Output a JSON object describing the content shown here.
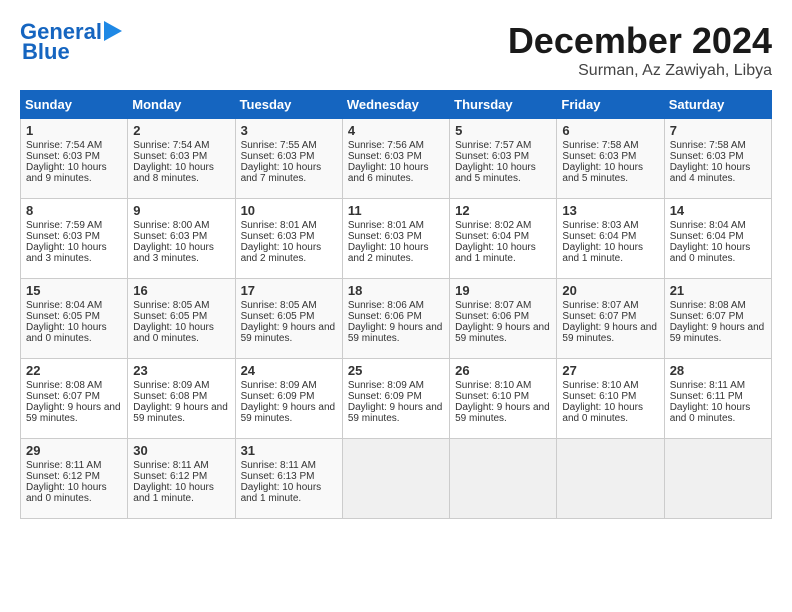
{
  "header": {
    "logo_line1": "General",
    "logo_line2": "Blue",
    "month": "December 2024",
    "location": "Surman, Az Zawiyah, Libya"
  },
  "days_of_week": [
    "Sunday",
    "Monday",
    "Tuesday",
    "Wednesday",
    "Thursday",
    "Friday",
    "Saturday"
  ],
  "weeks": [
    [
      {
        "day": 1,
        "info": "Sunrise: 7:54 AM\nSunset: 6:03 PM\nDaylight: 10 hours and 9 minutes."
      },
      {
        "day": 2,
        "info": "Sunrise: 7:54 AM\nSunset: 6:03 PM\nDaylight: 10 hours and 8 minutes."
      },
      {
        "day": 3,
        "info": "Sunrise: 7:55 AM\nSunset: 6:03 PM\nDaylight: 10 hours and 7 minutes."
      },
      {
        "day": 4,
        "info": "Sunrise: 7:56 AM\nSunset: 6:03 PM\nDaylight: 10 hours and 6 minutes."
      },
      {
        "day": 5,
        "info": "Sunrise: 7:57 AM\nSunset: 6:03 PM\nDaylight: 10 hours and 5 minutes."
      },
      {
        "day": 6,
        "info": "Sunrise: 7:58 AM\nSunset: 6:03 PM\nDaylight: 10 hours and 5 minutes."
      },
      {
        "day": 7,
        "info": "Sunrise: 7:58 AM\nSunset: 6:03 PM\nDaylight: 10 hours and 4 minutes."
      }
    ],
    [
      {
        "day": 8,
        "info": "Sunrise: 7:59 AM\nSunset: 6:03 PM\nDaylight: 10 hours and 3 minutes."
      },
      {
        "day": 9,
        "info": "Sunrise: 8:00 AM\nSunset: 6:03 PM\nDaylight: 10 hours and 3 minutes."
      },
      {
        "day": 10,
        "info": "Sunrise: 8:01 AM\nSunset: 6:03 PM\nDaylight: 10 hours and 2 minutes."
      },
      {
        "day": 11,
        "info": "Sunrise: 8:01 AM\nSunset: 6:03 PM\nDaylight: 10 hours and 2 minutes."
      },
      {
        "day": 12,
        "info": "Sunrise: 8:02 AM\nSunset: 6:04 PM\nDaylight: 10 hours and 1 minute."
      },
      {
        "day": 13,
        "info": "Sunrise: 8:03 AM\nSunset: 6:04 PM\nDaylight: 10 hours and 1 minute."
      },
      {
        "day": 14,
        "info": "Sunrise: 8:04 AM\nSunset: 6:04 PM\nDaylight: 10 hours and 0 minutes."
      }
    ],
    [
      {
        "day": 15,
        "info": "Sunrise: 8:04 AM\nSunset: 6:05 PM\nDaylight: 10 hours and 0 minutes."
      },
      {
        "day": 16,
        "info": "Sunrise: 8:05 AM\nSunset: 6:05 PM\nDaylight: 10 hours and 0 minutes."
      },
      {
        "day": 17,
        "info": "Sunrise: 8:05 AM\nSunset: 6:05 PM\nDaylight: 9 hours and 59 minutes."
      },
      {
        "day": 18,
        "info": "Sunrise: 8:06 AM\nSunset: 6:06 PM\nDaylight: 9 hours and 59 minutes."
      },
      {
        "day": 19,
        "info": "Sunrise: 8:07 AM\nSunset: 6:06 PM\nDaylight: 9 hours and 59 minutes."
      },
      {
        "day": 20,
        "info": "Sunrise: 8:07 AM\nSunset: 6:07 PM\nDaylight: 9 hours and 59 minutes."
      },
      {
        "day": 21,
        "info": "Sunrise: 8:08 AM\nSunset: 6:07 PM\nDaylight: 9 hours and 59 minutes."
      }
    ],
    [
      {
        "day": 22,
        "info": "Sunrise: 8:08 AM\nSunset: 6:07 PM\nDaylight: 9 hours and 59 minutes."
      },
      {
        "day": 23,
        "info": "Sunrise: 8:09 AM\nSunset: 6:08 PM\nDaylight: 9 hours and 59 minutes."
      },
      {
        "day": 24,
        "info": "Sunrise: 8:09 AM\nSunset: 6:09 PM\nDaylight: 9 hours and 59 minutes."
      },
      {
        "day": 25,
        "info": "Sunrise: 8:09 AM\nSunset: 6:09 PM\nDaylight: 9 hours and 59 minutes."
      },
      {
        "day": 26,
        "info": "Sunrise: 8:10 AM\nSunset: 6:10 PM\nDaylight: 9 hours and 59 minutes."
      },
      {
        "day": 27,
        "info": "Sunrise: 8:10 AM\nSunset: 6:10 PM\nDaylight: 10 hours and 0 minutes."
      },
      {
        "day": 28,
        "info": "Sunrise: 8:11 AM\nSunset: 6:11 PM\nDaylight: 10 hours and 0 minutes."
      }
    ],
    [
      {
        "day": 29,
        "info": "Sunrise: 8:11 AM\nSunset: 6:12 PM\nDaylight: 10 hours and 0 minutes."
      },
      {
        "day": 30,
        "info": "Sunrise: 8:11 AM\nSunset: 6:12 PM\nDaylight: 10 hours and 1 minute."
      },
      {
        "day": 31,
        "info": "Sunrise: 8:11 AM\nSunset: 6:13 PM\nDaylight: 10 hours and 1 minute."
      },
      null,
      null,
      null,
      null
    ]
  ]
}
